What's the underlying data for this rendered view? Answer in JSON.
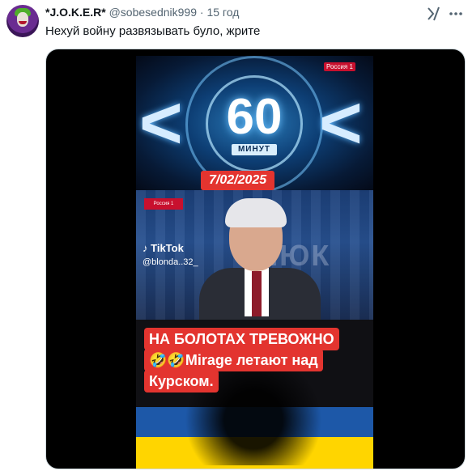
{
  "tweet": {
    "display_name": "*J.O.K.E.R*",
    "handle": "@sobesednik999",
    "separator": "·",
    "time": "15 год",
    "text": "Нехуй войну развязывать було, жрите"
  },
  "icons": {
    "grok": "grok-icon",
    "more": "more-icon"
  },
  "video": {
    "show_number": "60",
    "show_word": "МИНУТ",
    "channel": "Россия 1",
    "date_badge": "7/02/2025",
    "tiktok_label": "TikTok",
    "tiktok_handle": "@blonda..32_",
    "studio_watermark": "ЛЮК",
    "caption_lines": [
      "НА БОЛОТАХ ТРЕВОЖНО",
      "🤣🤣Mirage летают над",
      "Курском."
    ]
  },
  "colors": {
    "badge_red": "#e3342f",
    "flag_blue": "#1d58a8",
    "flag_yellow": "#ffd500"
  }
}
